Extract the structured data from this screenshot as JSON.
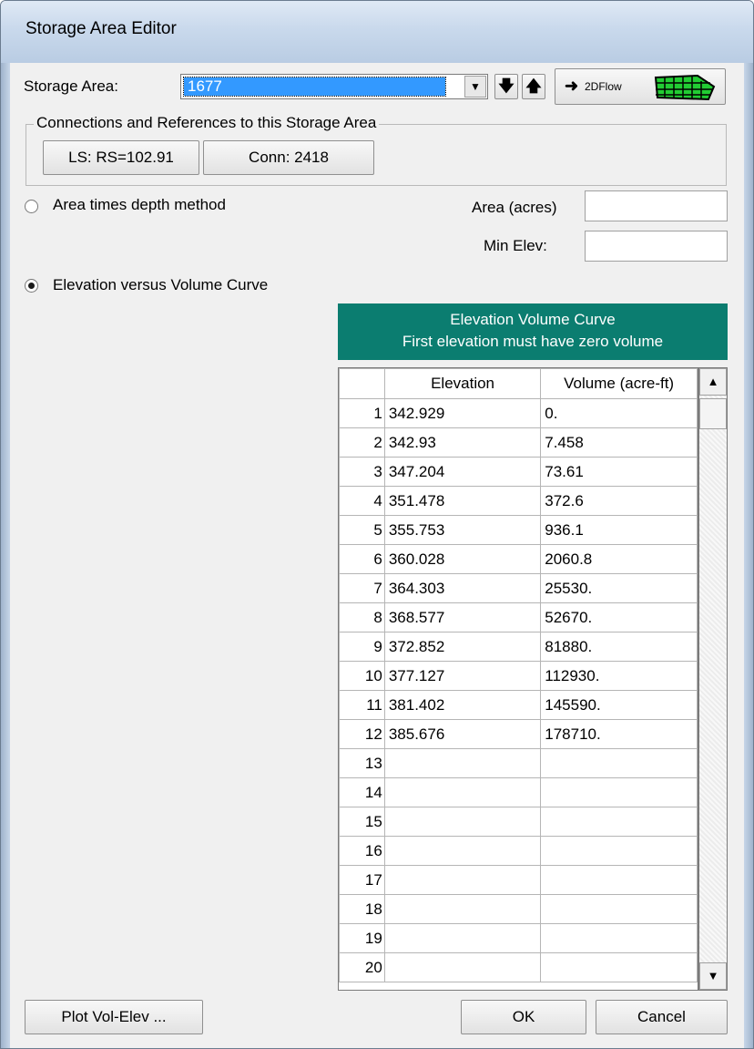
{
  "window": {
    "title": "Storage Area Editor"
  },
  "storage_area": {
    "label": "Storage Area:",
    "selected": "1677",
    "flow_button_label": "2DFlow"
  },
  "connections": {
    "group_title": "Connections and References to this Storage Area",
    "buttons": [
      "LS: RS=102.91",
      "Conn: 2418"
    ]
  },
  "method": {
    "area_depth_label": "Area times depth method",
    "area_depth_selected": false,
    "area_label": "Area (acres)",
    "area_value": "",
    "min_elev_label": "Min Elev:",
    "min_elev_value": "",
    "elev_volume_label": "Elevation versus Volume Curve",
    "elev_volume_selected": true
  },
  "curve": {
    "title_line1": "Elevation Volume Curve",
    "title_line2": "First elevation must have zero volume",
    "columns": [
      "Elevation",
      "Volume (acre-ft)"
    ],
    "rows": [
      {
        "n": "1",
        "elevation": "342.929",
        "volume": "0."
      },
      {
        "n": "2",
        "elevation": "342.93",
        "volume": "7.458"
      },
      {
        "n": "3",
        "elevation": "347.204",
        "volume": "73.61"
      },
      {
        "n": "4",
        "elevation": "351.478",
        "volume": "372.6"
      },
      {
        "n": "5",
        "elevation": "355.753",
        "volume": "936.1"
      },
      {
        "n": "6",
        "elevation": "360.028",
        "volume": "2060.8"
      },
      {
        "n": "7",
        "elevation": "364.303",
        "volume": "25530."
      },
      {
        "n": "8",
        "elevation": "368.577",
        "volume": "52670."
      },
      {
        "n": "9",
        "elevation": "372.852",
        "volume": "81880."
      },
      {
        "n": "10",
        "elevation": "377.127",
        "volume": "112930."
      },
      {
        "n": "11",
        "elevation": "381.402",
        "volume": "145590."
      },
      {
        "n": "12",
        "elevation": "385.676",
        "volume": "178710."
      },
      {
        "n": "13",
        "elevation": "",
        "volume": ""
      },
      {
        "n": "14",
        "elevation": "",
        "volume": ""
      },
      {
        "n": "15",
        "elevation": "",
        "volume": ""
      },
      {
        "n": "16",
        "elevation": "",
        "volume": ""
      },
      {
        "n": "17",
        "elevation": "",
        "volume": ""
      },
      {
        "n": "18",
        "elevation": "",
        "volume": ""
      },
      {
        "n": "19",
        "elevation": "",
        "volume": ""
      },
      {
        "n": "20",
        "elevation": "",
        "volume": ""
      }
    ]
  },
  "footer": {
    "plot_label": "Plot Vol-Elev ...",
    "ok_label": "OK",
    "cancel_label": "Cancel"
  },
  "colors": {
    "curve_header": "#0b7d70",
    "selection": "#3399ff"
  }
}
